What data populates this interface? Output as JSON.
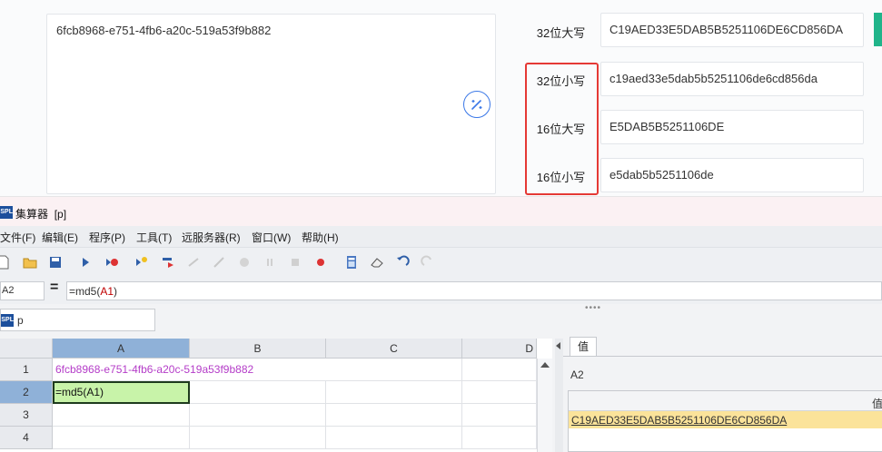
{
  "tool": {
    "input_text": "6fcb8968-e751-4fb6-a20c-519a53f9b882",
    "results": [
      {
        "label": "32位大写",
        "value": "C19AED33E5DAB5B5251106DE6CD856DA"
      },
      {
        "label": "32位小写",
        "value": "c19aed33e5dab5b5251106de6cd856da"
      },
      {
        "label": "16位大写",
        "value": "E5DAB5B5251106DE"
      },
      {
        "label": "16位小写",
        "value": "e5dab5b5251106de"
      }
    ],
    "highlight_color": "#e53935",
    "accent_color": "#20b48a"
  },
  "ide": {
    "icon_text": "SPL",
    "title": "集算器",
    "title_file": "[p]",
    "menu": [
      "文件(F)",
      "编辑(E)",
      "程序(P)",
      "工具(T)",
      "远服务器(R)",
      "窗口(W)",
      "帮助(H)"
    ],
    "toolbar_icons": [
      "new-file-icon",
      "open-folder-icon",
      "save-icon",
      "run-icon",
      "debug-icon",
      "step-icon",
      "step-into-icon",
      "step-over-icon",
      "step-return-icon",
      "breakpoint-icon",
      "pause-icon",
      "stop-icon",
      "record-icon",
      "calculator-icon",
      "eraser-icon",
      "undo-icon",
      "redo-icon"
    ],
    "cell_ref": "A2",
    "formula_prefix": "=md5(",
    "formula_ref": "A1",
    "formula_suffix": ")",
    "file_tab": "p",
    "grid": {
      "columns": [
        "A",
        "B",
        "C",
        "D"
      ],
      "rows": [
        "1",
        "2",
        "3",
        "4"
      ],
      "a1": "6fcb8968-e751-4fb6-a20c-519a53f9b882",
      "a2": "=md5(A1)"
    },
    "value_panel": {
      "tab": "值",
      "cell": "A2",
      "header": "值",
      "value": "C19AED33E5DAB5B5251106DE6CD856DA"
    }
  }
}
